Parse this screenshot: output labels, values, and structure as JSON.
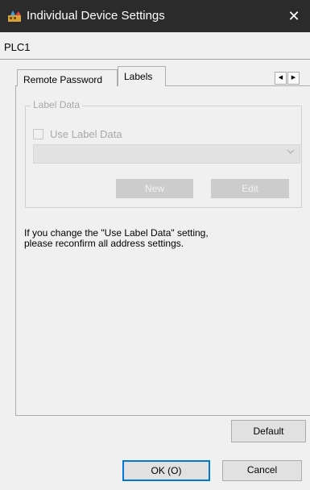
{
  "window": {
    "title": "Individual Device Settings",
    "close_glyph": "✕"
  },
  "device": {
    "name": "PLC1"
  },
  "tabs": [
    {
      "label": "Remote Password",
      "selected": false
    },
    {
      "label": "Labels",
      "selected": true
    }
  ],
  "tab_scroll": {
    "left_glyph": "◀",
    "right_glyph": "▶"
  },
  "label_data": {
    "group_title": "Label Data",
    "checkbox_label": "Use Label Data",
    "checkbox_checked": false,
    "checkbox_enabled": false,
    "combo_value": "",
    "new_button": "New",
    "edit_button": "Edit"
  },
  "info": {
    "line1": "If you change the \"Use Label Data\" setting,",
    "line2": "please reconfirm all address settings."
  },
  "buttons": {
    "default": "Default",
    "ok": "OK (O)",
    "cancel": "Cancel"
  },
  "colors": {
    "titlebar": "#2b2b2b",
    "focus_border": "#0078d7",
    "disabled_text": "#a8a8a8"
  }
}
